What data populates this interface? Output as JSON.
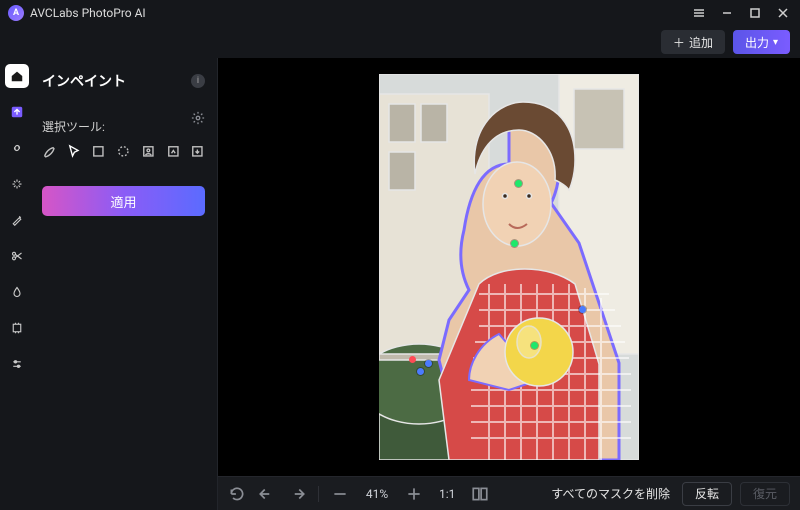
{
  "app": {
    "title": "AVCLabs PhotoPro AI"
  },
  "header": {
    "add_label": "追加",
    "export_label": "出力"
  },
  "panel": {
    "title": "インペイント",
    "section_label": "選択ツール:",
    "apply_label": "適用"
  },
  "bottom": {
    "zoom_value": "41%",
    "fit_label": "1:1",
    "clear_masks_label": "すべてのマスクを削除",
    "invert_label": "反転",
    "restore_label": "復元"
  },
  "icons": {
    "home": "home-icon",
    "upload": "upload-icon"
  }
}
